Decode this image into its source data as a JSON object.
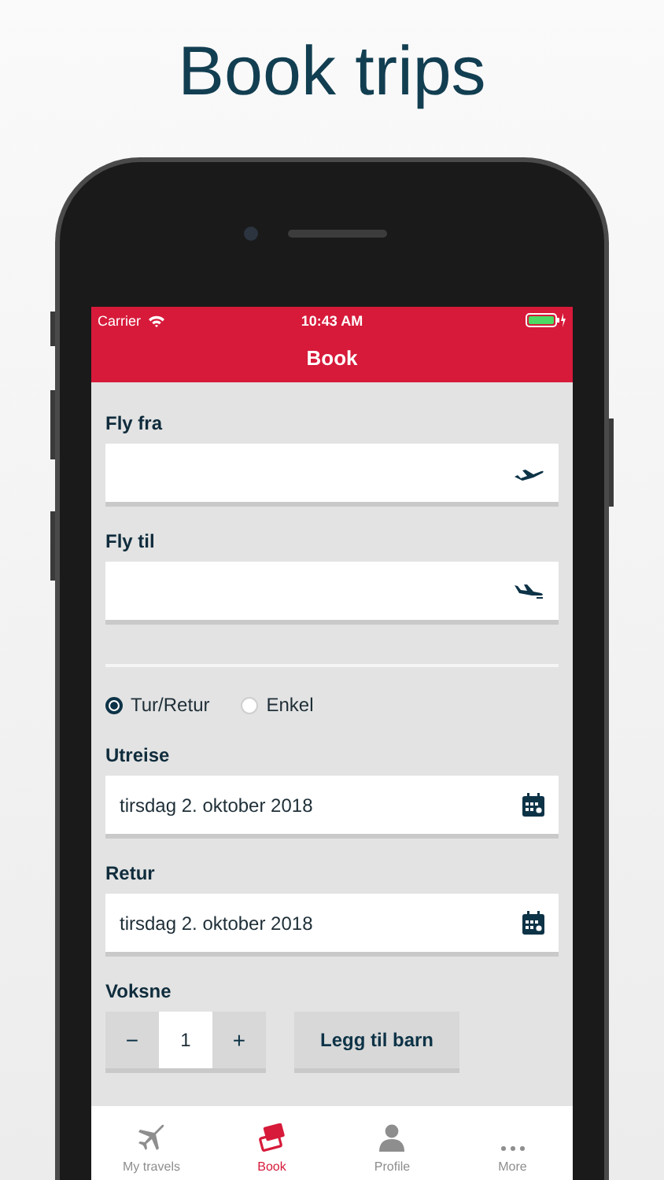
{
  "page_title": "Book trips",
  "status_bar": {
    "carrier": "Carrier",
    "time": "10:43 AM"
  },
  "nav_bar": {
    "title": "Book"
  },
  "airports": [
    {
      "label": "Fly fra",
      "kind": "takeoff"
    },
    {
      "label": "Fly til",
      "kind": "landing"
    }
  ],
  "trip_types": [
    {
      "label": "Tur/Retur",
      "selected": true
    },
    {
      "label": "Enkel",
      "selected": false
    }
  ],
  "dates": [
    {
      "label": "Utreise",
      "value": "tirsdag 2. oktober 2018"
    },
    {
      "label": "Retur",
      "value": "tirsdag 2. oktober 2018"
    }
  ],
  "passengers": {
    "label": "Voksne",
    "minus": "−",
    "count": "1",
    "plus": "+",
    "add_child": "Legg til barn"
  },
  "tab_bar": [
    {
      "label": "My travels",
      "kind": "plane",
      "selected": false
    },
    {
      "label": "Book",
      "kind": "tickets",
      "selected": true
    },
    {
      "label": "Profile",
      "kind": "person",
      "selected": false
    },
    {
      "label": "More",
      "kind": "dots",
      "selected": false
    }
  ]
}
